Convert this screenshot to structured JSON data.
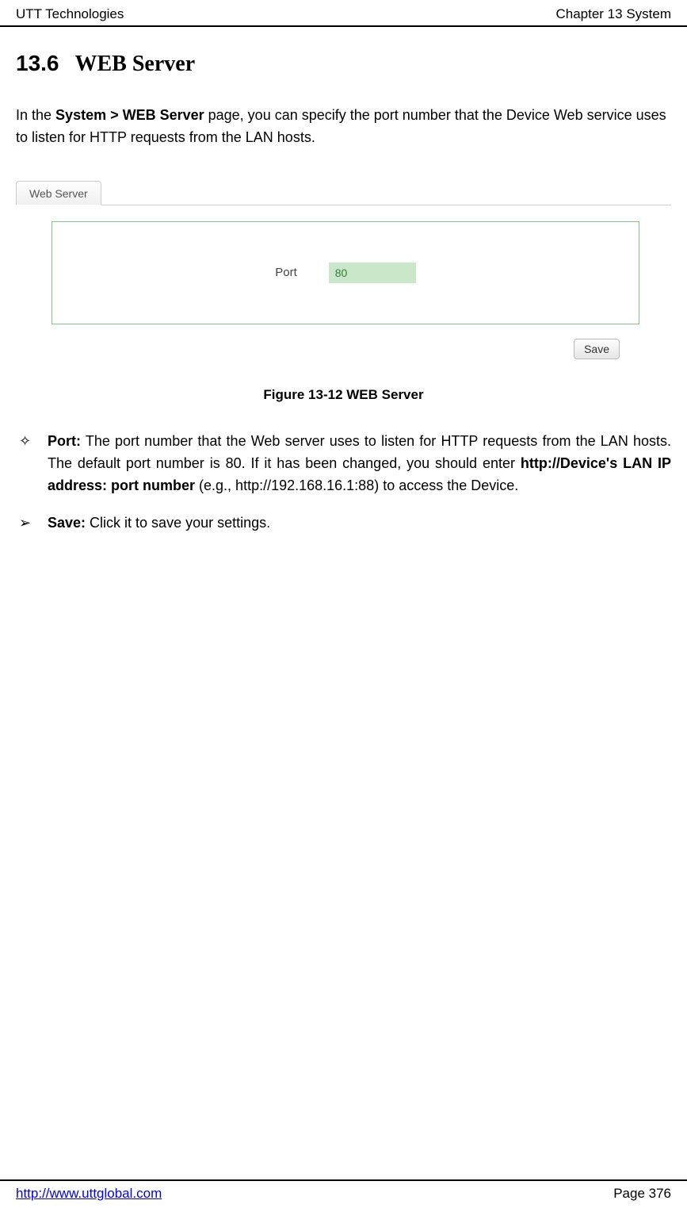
{
  "header": {
    "left": "UTT Technologies",
    "right": "Chapter 13 System"
  },
  "section": {
    "number": "13.6",
    "title": "WEB Server"
  },
  "intro": {
    "prefix": "In the ",
    "bold": "System > WEB Server",
    "suffix": " page, you can specify the port number that the Device Web service uses to listen for HTTP requests from the LAN hosts."
  },
  "screenshot": {
    "tab_label": "Web Server",
    "port_label": "Port",
    "port_value": "80",
    "save_label": "Save"
  },
  "figure_caption": "Figure 13-12 WEB Server",
  "bullets": {
    "port": {
      "marker": "✧",
      "label": "Port:",
      "text_before": " The port number that the Web server uses to listen for HTTP requests from the LAN hosts. The default port number is 80. If it has been changed, you should enter ",
      "bold2": "http://Device's LAN IP address: port number",
      "text_after": " (e.g., http://192.168.16.1:88) to access the Device."
    },
    "save": {
      "marker": "➢",
      "label": "Save:",
      "text": " Click it to save your settings."
    }
  },
  "footer": {
    "url": "http://www.uttglobal.com",
    "page": "Page 376"
  }
}
